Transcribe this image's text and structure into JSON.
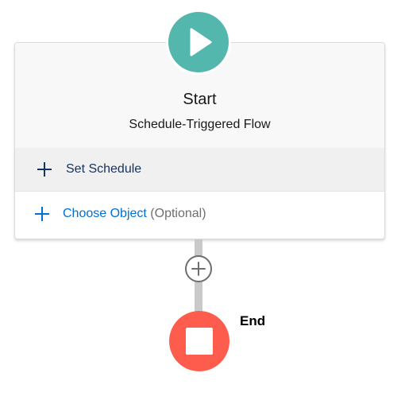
{
  "start_node": {
    "title": "Start",
    "subtitle": "Schedule-Triggered Flow",
    "icon": "play-icon",
    "color": "#54b7ae"
  },
  "actions": {
    "set_schedule": {
      "label": "Set Schedule",
      "icon": "plus-icon"
    },
    "choose_object": {
      "label": "Choose Object",
      "optional_text": "(Optional)",
      "icon": "plus-icon"
    }
  },
  "add_element": {
    "icon": "plus-circle-icon"
  },
  "end_node": {
    "label": "End",
    "icon": "stop-icon",
    "color": "#fe5c4c"
  },
  "colors": {
    "link_blue": "#0070d2",
    "dark_navy": "#16325c",
    "connector_gray": "#c9c9c9"
  }
}
